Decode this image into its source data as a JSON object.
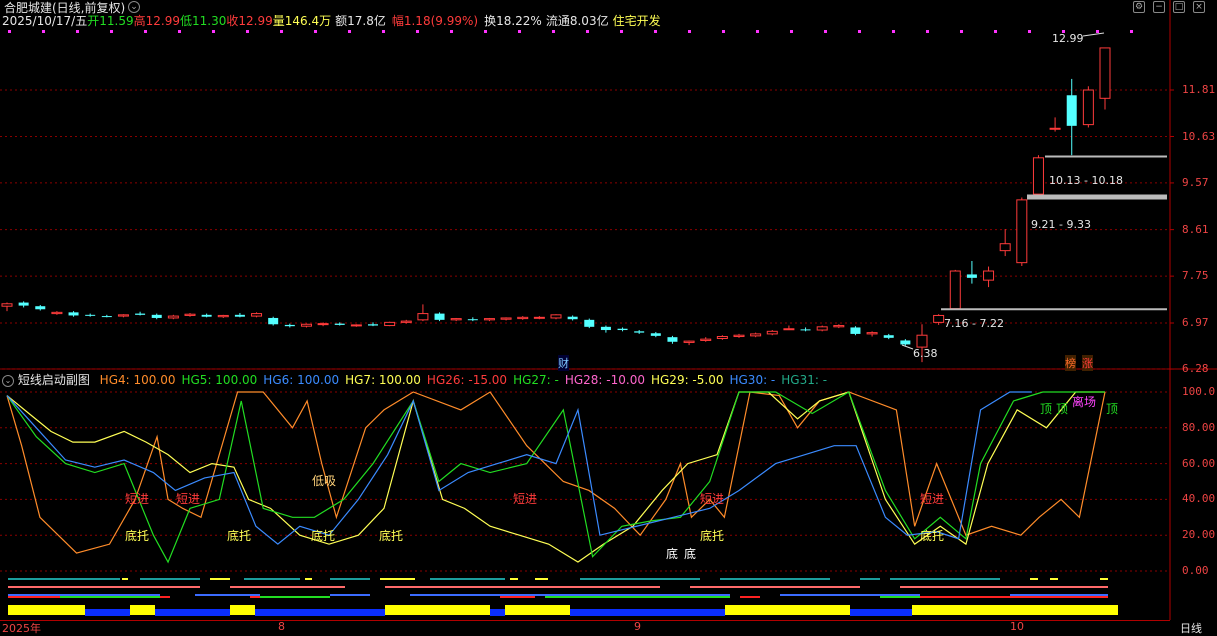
{
  "window": {
    "title": "合肥城建(日线,前复权)"
  },
  "quote": {
    "date": "2025/10/17/五",
    "open_label": "开",
    "open": "11.59",
    "high_label": "高",
    "high": "12.99",
    "low_label": "低",
    "low": "11.30",
    "close_label": "收",
    "close": "12.99",
    "vol_label": "量",
    "vol": "146.4万",
    "amt_label": "额",
    "amt": "17.8亿",
    "chg_label": "幅",
    "chg": "1.18(9.99%)",
    "turn_label": "换",
    "turn": "18.22%",
    "float_label": "流通",
    "float": "8.03亿",
    "sector": "住宅开发"
  },
  "colors": {
    "up": "#ff3b3b",
    "down": "#54ffff",
    "grid": "#8b0000",
    "axis": "#b00000"
  },
  "price_axis": {
    "ticks": [
      "11.81",
      "10.63",
      "9.57",
      "8.61",
      "7.75",
      "6.97",
      "6.28"
    ]
  },
  "annotations": {
    "high_mark": "12.99",
    "low_mark": "6.38",
    "zone1": "10.13 - 10.18",
    "zone2": "9.21 - 9.33",
    "zone3": "7.16 - 7.22",
    "fin_badge": "财",
    "bang_badge": "榜",
    "zhang_badge": "涨"
  },
  "indicator": {
    "name": "短线启动副图",
    "values": [
      {
        "label": "HG4: 100.00",
        "color": "#ff8c2a"
      },
      {
        "label": "HG5: 100.00",
        "color": "#22dd22"
      },
      {
        "label": "HG6: 100.00",
        "color": "#3b8bff"
      },
      {
        "label": "HG7: 100.00",
        "color": "#ffff55"
      },
      {
        "label": "HG26: -15.00",
        "color": "#ff3b3b"
      },
      {
        "label": "HG27: -",
        "color": "#22dd22"
      },
      {
        "label": "HG28: -10.00",
        "color": "#ff66cc"
      },
      {
        "label": "HG29: -5.00",
        "color": "#ffff55"
      },
      {
        "label": "HG30: -",
        "color": "#3b8bff"
      },
      {
        "label": "HG31: -",
        "color": "#22aa88"
      }
    ],
    "axis_ticks": [
      "100.0",
      "80.00",
      "60.00",
      "40.00",
      "20.00",
      "0.00"
    ],
    "signals": {
      "short_entry": "短进",
      "bottom_support": "底托",
      "low_absorb": "低吸",
      "bottom": "底",
      "top": "顶",
      "sell": "离场"
    }
  },
  "time_axis": {
    "labels": [
      "2025年",
      "8",
      "9",
      "10"
    ],
    "period": "日线"
  },
  "chart_data": {
    "type": "candlestick",
    "title": "合肥城建(日线,前复权)",
    "price_ticks": [
      6.28,
      6.97,
      7.75,
      8.61,
      9.57,
      10.63,
      11.81
    ],
    "candles": [
      {
        "o": 7.24,
        "h": 7.3,
        "l": 7.16,
        "c": 7.28
      },
      {
        "o": 7.3,
        "h": 7.32,
        "l": 7.22,
        "c": 7.25
      },
      {
        "o": 7.24,
        "h": 7.26,
        "l": 7.17,
        "c": 7.19
      },
      {
        "o": 7.12,
        "h": 7.16,
        "l": 7.1,
        "c": 7.14
      },
      {
        "o": 7.14,
        "h": 7.16,
        "l": 7.07,
        "c": 7.09
      },
      {
        "o": 7.1,
        "h": 7.12,
        "l": 7.07,
        "c": 7.09
      },
      {
        "o": 7.08,
        "h": 7.1,
        "l": 7.06,
        "c": 7.07
      },
      {
        "o": 7.08,
        "h": 7.11,
        "l": 7.06,
        "c": 7.1
      },
      {
        "o": 7.12,
        "h": 7.15,
        "l": 7.09,
        "c": 7.1
      },
      {
        "o": 7.1,
        "h": 7.12,
        "l": 7.03,
        "c": 7.05
      },
      {
        "o": 7.05,
        "h": 7.1,
        "l": 7.03,
        "c": 7.08
      },
      {
        "o": 7.09,
        "h": 7.13,
        "l": 7.07,
        "c": 7.11
      },
      {
        "o": 7.1,
        "h": 7.12,
        "l": 7.06,
        "c": 7.07
      },
      {
        "o": 7.07,
        "h": 7.1,
        "l": 7.05,
        "c": 7.09
      },
      {
        "o": 7.1,
        "h": 7.13,
        "l": 7.06,
        "c": 7.07
      },
      {
        "o": 7.08,
        "h": 7.14,
        "l": 7.06,
        "c": 7.12
      },
      {
        "o": 7.05,
        "h": 7.07,
        "l": 6.93,
        "c": 6.95
      },
      {
        "o": 6.94,
        "h": 6.96,
        "l": 6.9,
        "c": 6.92
      },
      {
        "o": 6.92,
        "h": 6.96,
        "l": 6.9,
        "c": 6.95
      },
      {
        "o": 6.95,
        "h": 6.98,
        "l": 6.92,
        "c": 6.96
      },
      {
        "o": 6.96,
        "h": 6.98,
        "l": 6.93,
        "c": 6.94
      },
      {
        "o": 6.93,
        "h": 6.95,
        "l": 6.91,
        "c": 6.94
      },
      {
        "o": 6.95,
        "h": 6.98,
        "l": 6.92,
        "c": 6.93
      },
      {
        "o": 6.93,
        "h": 6.99,
        "l": 6.92,
        "c": 6.98
      },
      {
        "o": 6.98,
        "h": 7.02,
        "l": 6.96,
        "c": 7.0
      },
      {
        "o": 7.02,
        "h": 7.27,
        "l": 7.0,
        "c": 7.12
      },
      {
        "o": 7.12,
        "h": 7.14,
        "l": 7.0,
        "c": 7.02
      },
      {
        "o": 7.02,
        "h": 7.05,
        "l": 7.0,
        "c": 7.04
      },
      {
        "o": 7.03,
        "h": 7.06,
        "l": 7.0,
        "c": 7.02
      },
      {
        "o": 7.02,
        "h": 7.05,
        "l": 7.0,
        "c": 7.04
      },
      {
        "o": 7.03,
        "h": 7.06,
        "l": 7.01,
        "c": 7.05
      },
      {
        "o": 7.04,
        "h": 7.08,
        "l": 7.02,
        "c": 7.06
      },
      {
        "o": 7.05,
        "h": 7.08,
        "l": 7.03,
        "c": 7.06
      },
      {
        "o": 7.05,
        "h": 7.11,
        "l": 7.03,
        "c": 7.1
      },
      {
        "o": 7.07,
        "h": 7.09,
        "l": 7.01,
        "c": 7.03
      },
      {
        "o": 7.02,
        "h": 7.04,
        "l": 6.89,
        "c": 6.91
      },
      {
        "o": 6.91,
        "h": 6.93,
        "l": 6.82,
        "c": 6.86
      },
      {
        "o": 6.88,
        "h": 6.9,
        "l": 6.84,
        "c": 6.86
      },
      {
        "o": 6.84,
        "h": 6.86,
        "l": 6.8,
        "c": 6.82
      },
      {
        "o": 6.81,
        "h": 6.83,
        "l": 6.75,
        "c": 6.77
      },
      {
        "o": 6.75,
        "h": 6.77,
        "l": 6.65,
        "c": 6.68
      },
      {
        "o": 6.67,
        "h": 6.7,
        "l": 6.63,
        "c": 6.69
      },
      {
        "o": 6.7,
        "h": 6.75,
        "l": 6.68,
        "c": 6.72
      },
      {
        "o": 6.73,
        "h": 6.78,
        "l": 6.71,
        "c": 6.76
      },
      {
        "o": 6.76,
        "h": 6.8,
        "l": 6.74,
        "c": 6.78
      },
      {
        "o": 6.77,
        "h": 6.82,
        "l": 6.75,
        "c": 6.8
      },
      {
        "o": 6.8,
        "h": 6.86,
        "l": 6.78,
        "c": 6.84
      },
      {
        "o": 6.88,
        "h": 6.93,
        "l": 6.86,
        "c": 6.88
      },
      {
        "o": 6.87,
        "h": 6.9,
        "l": 6.84,
        "c": 6.86
      },
      {
        "o": 6.86,
        "h": 6.93,
        "l": 6.84,
        "c": 6.91
      },
      {
        "o": 6.91,
        "h": 6.95,
        "l": 6.89,
        "c": 6.93
      },
      {
        "o": 6.9,
        "h": 6.92,
        "l": 6.78,
        "c": 6.8
      },
      {
        "o": 6.8,
        "h": 6.84,
        "l": 6.76,
        "c": 6.82
      },
      {
        "o": 6.78,
        "h": 6.8,
        "l": 6.72,
        "c": 6.74
      },
      {
        "o": 6.7,
        "h": 6.72,
        "l": 6.62,
        "c": 6.64
      },
      {
        "o": 6.6,
        "h": 6.95,
        "l": 6.38,
        "c": 6.78
      },
      {
        "o": 6.98,
        "h": 7.11,
        "l": 6.94,
        "c": 7.09
      },
      {
        "o": 7.2,
        "h": 7.86,
        "l": 7.19,
        "c": 7.84
      },
      {
        "o": 7.78,
        "h": 8.02,
        "l": 7.62,
        "c": 7.72
      },
      {
        "o": 7.68,
        "h": 7.92,
        "l": 7.56,
        "c": 7.84
      },
      {
        "o": 8.21,
        "h": 8.62,
        "l": 8.11,
        "c": 8.34
      },
      {
        "o": 7.99,
        "h": 9.26,
        "l": 7.93,
        "c": 9.21
      },
      {
        "o": 9.33,
        "h": 10.19,
        "l": 9.28,
        "c": 10.13
      },
      {
        "o": 10.83,
        "h": 11.1,
        "l": 10.75,
        "c": 10.83
      },
      {
        "o": 11.67,
        "h": 12.11,
        "l": 10.19,
        "c": 10.89
      },
      {
        "o": 10.92,
        "h": 11.91,
        "l": 10.85,
        "c": 11.81
      },
      {
        "o": 11.59,
        "h": 12.99,
        "l": 11.3,
        "c": 12.99
      }
    ]
  }
}
